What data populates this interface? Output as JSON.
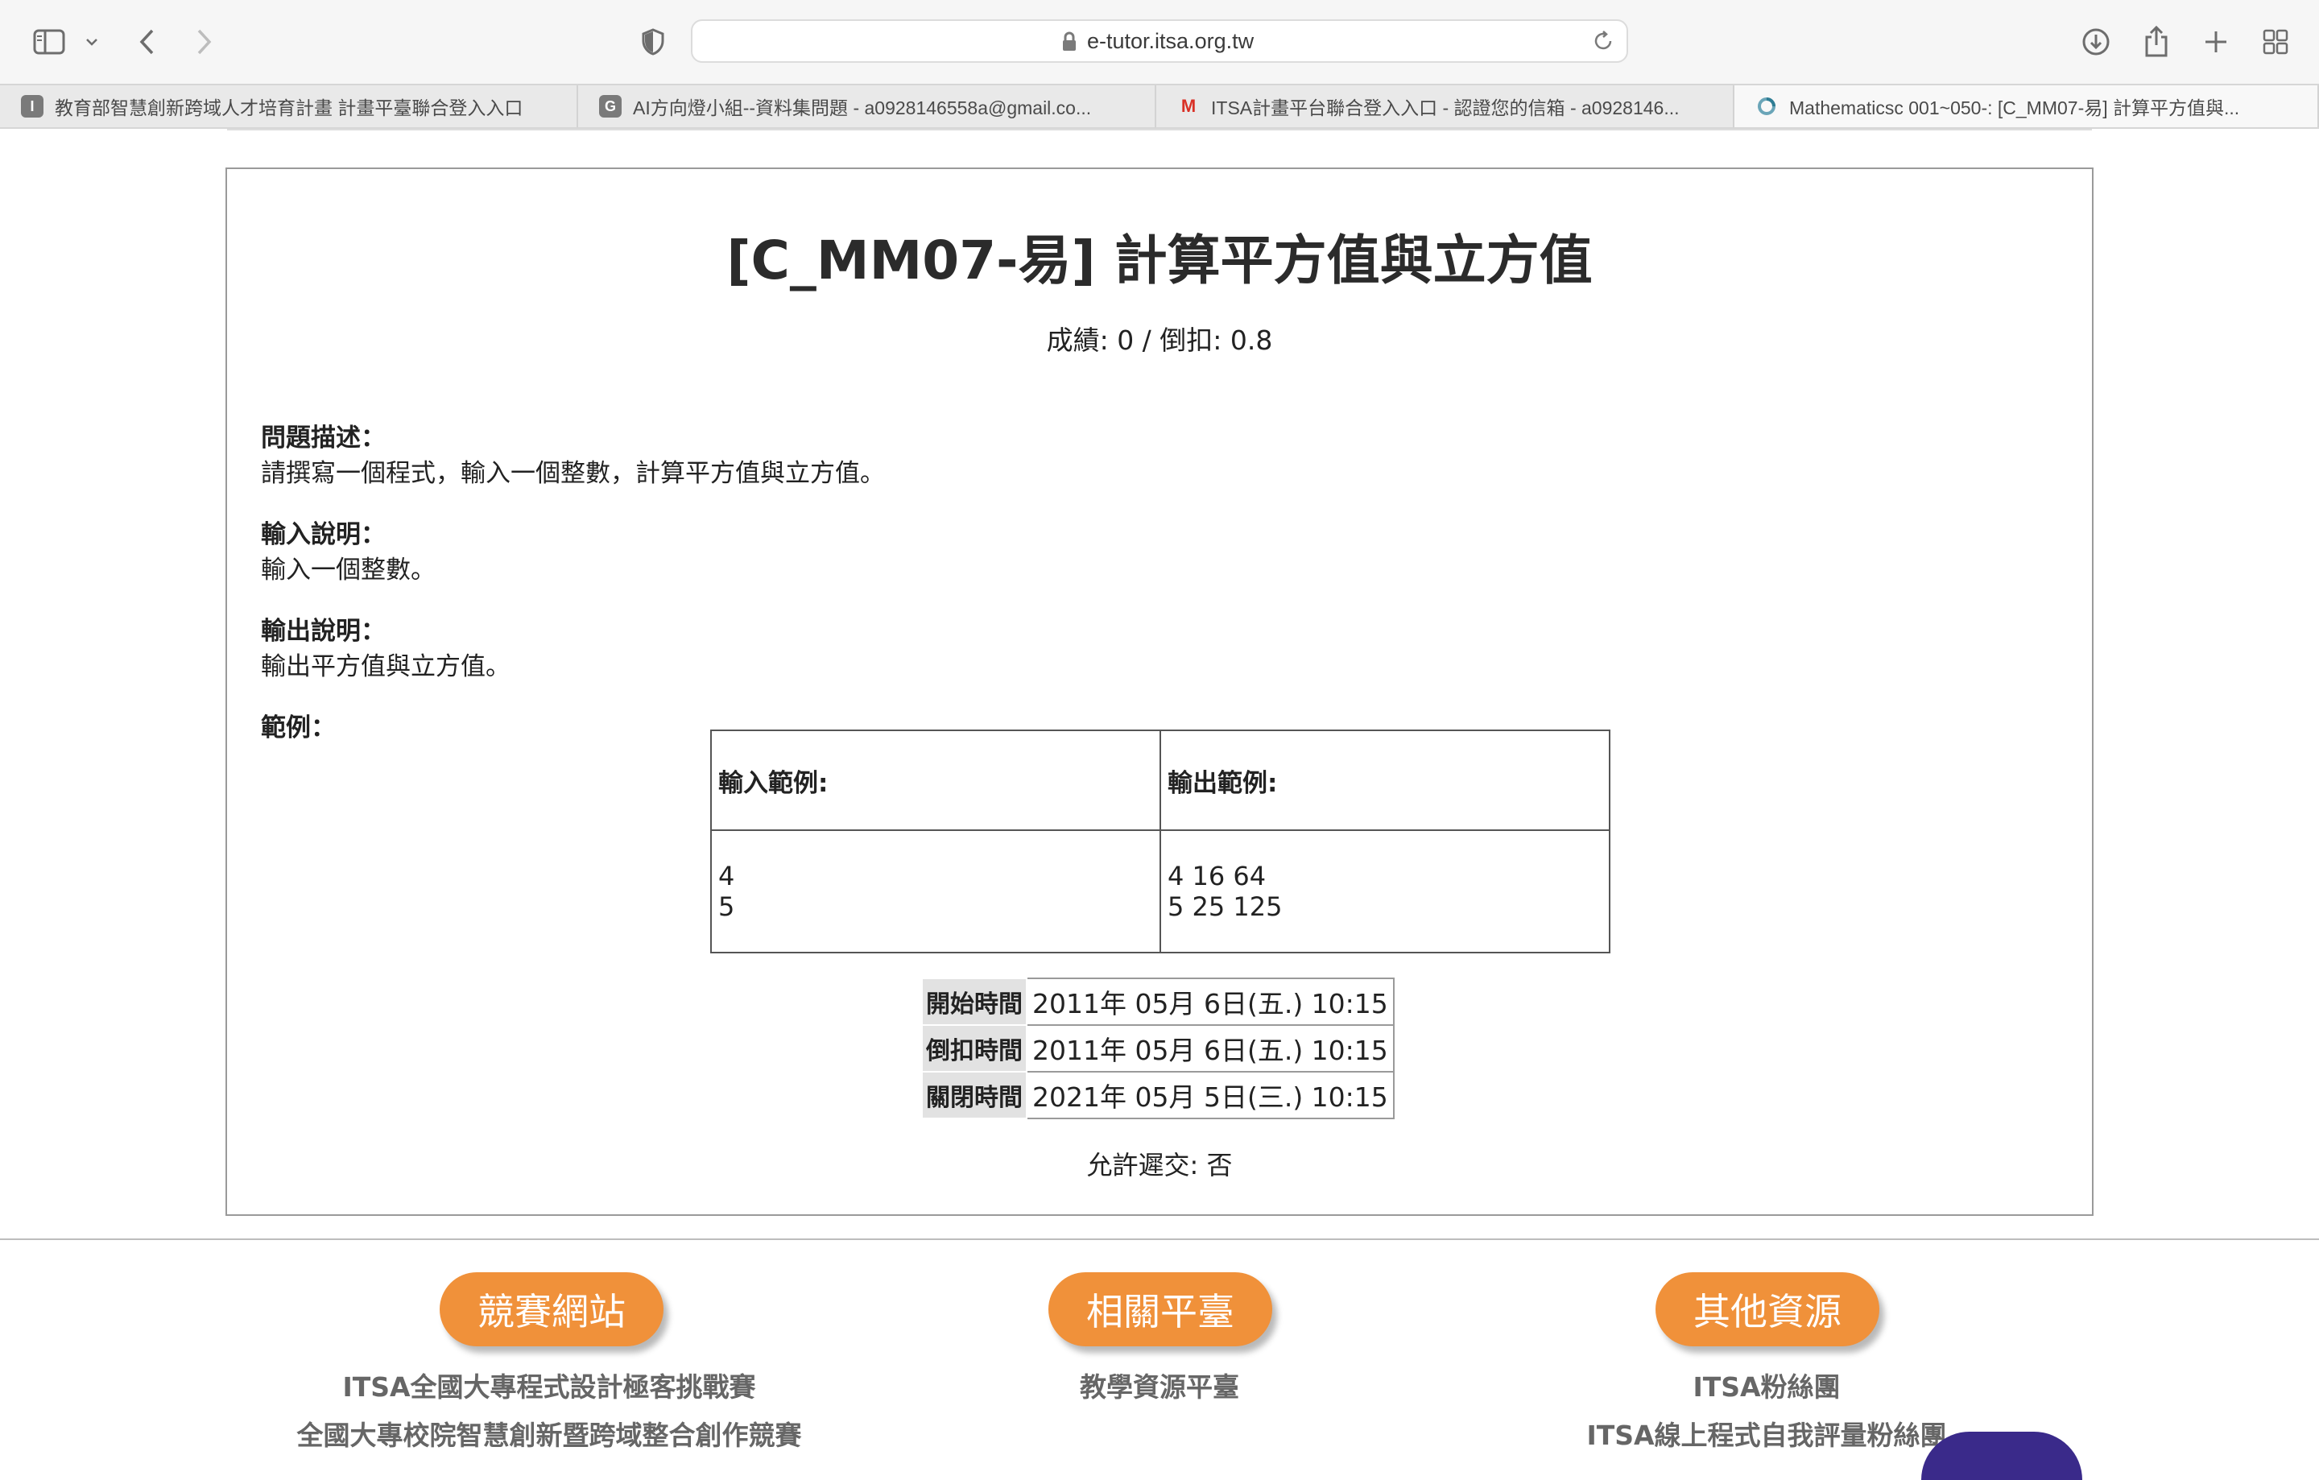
{
  "browser": {
    "url": "e-tutor.itsa.org.tw",
    "tabs": [
      {
        "favicon": "I",
        "title": "教育部智慧創新跨域人才培育計畫 計畫平臺聯合登入入口",
        "active": false
      },
      {
        "favicon": "G",
        "title": "AI方向燈小組--資料集問題 - a0928146558a@gmail.co...",
        "active": false
      },
      {
        "favicon": "M",
        "title": "ITSA計畫平台聯合登入入口 - 認證您的信箱 - a0928146...",
        "active": false
      },
      {
        "favicon": "",
        "title": "Mathematicsc 001~050-: [C_MM07-易] 計算平方值與...",
        "active": true
      }
    ],
    "icons": [
      "sidebar-icon",
      "chevron-down-icon",
      "back-icon",
      "forward-icon",
      "shield-icon",
      "lock-icon",
      "reload-icon",
      "download-icon",
      "share-icon",
      "new-tab-icon",
      "tab-overview-icon"
    ]
  },
  "problem": {
    "title": "[C_MM07-易] 計算平方值與立方值",
    "score": "成績: 0 / 倒扣: 0.8",
    "desc_head": "問題描述：",
    "desc_body": "請撰寫一個程式，輸入一個整數，計算平方值與立方值。",
    "input_head": "輸入說明：",
    "input_body": "輸入一個整數。",
    "output_head": "輸出說明：",
    "output_body": "輸出平方值與立方值。",
    "example_head": "範例：",
    "sample": {
      "input_label": "輸入範例:",
      "output_label": "輸出範例:",
      "input_value": "4\n5",
      "output_value": "4 16 64\n5 25 125"
    },
    "times": [
      {
        "label": "開始時間",
        "value": "2011年 05月 6日(五.) 10:15"
      },
      {
        "label": "倒扣時間",
        "value": "2011年 05月 6日(五.) 10:15"
      },
      {
        "label": "關閉時間",
        "value": "2021年 05月 5日(三.) 10:15"
      }
    ],
    "late": "允許遲交: 否"
  },
  "footer": {
    "pills": [
      "競賽網站",
      "相關平臺",
      "其他資源"
    ],
    "col1": [
      "ITSA全國大專程式設計極客挑戰賽",
      "全國大專校院智慧創新暨跨域整合創作競賽"
    ],
    "col2": [
      "教學資源平臺"
    ],
    "col3": [
      "ITSA粉絲團",
      "ITSA線上程式自我評量粉絲團"
    ]
  },
  "colors": {
    "accent": "#f0913a",
    "gmail_red": "#d93025",
    "favicon_gray": "#7a7a7a"
  }
}
